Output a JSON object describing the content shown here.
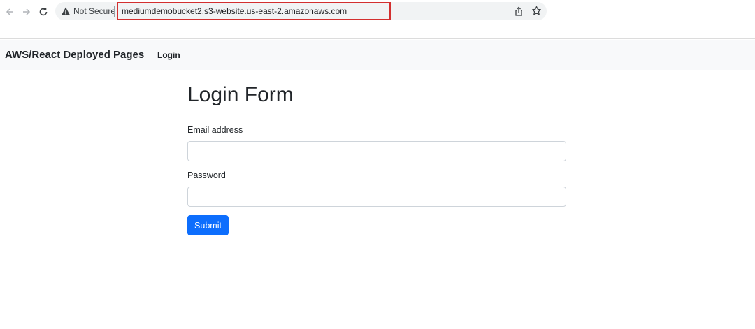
{
  "browser": {
    "security_label": "Not Secure",
    "url": "mediumdemobucket2.s3-website.us-east-2.amazonaws.com",
    "highlight_color": "#d32f2f",
    "icons": [
      "back-arrow-icon",
      "forward-arrow-icon",
      "reload-icon",
      "warning-icon",
      "share-icon",
      "bookmark-star-icon"
    ]
  },
  "navbar": {
    "brand": "AWS/React Deployed Pages",
    "links": [
      {
        "label": "Login"
      }
    ]
  },
  "form": {
    "title": "Login Form",
    "email_label": "Email address",
    "email_value": "",
    "password_label": "Password",
    "password_value": "",
    "submit_label": "Submit",
    "submit_color": "#0d6efd"
  }
}
